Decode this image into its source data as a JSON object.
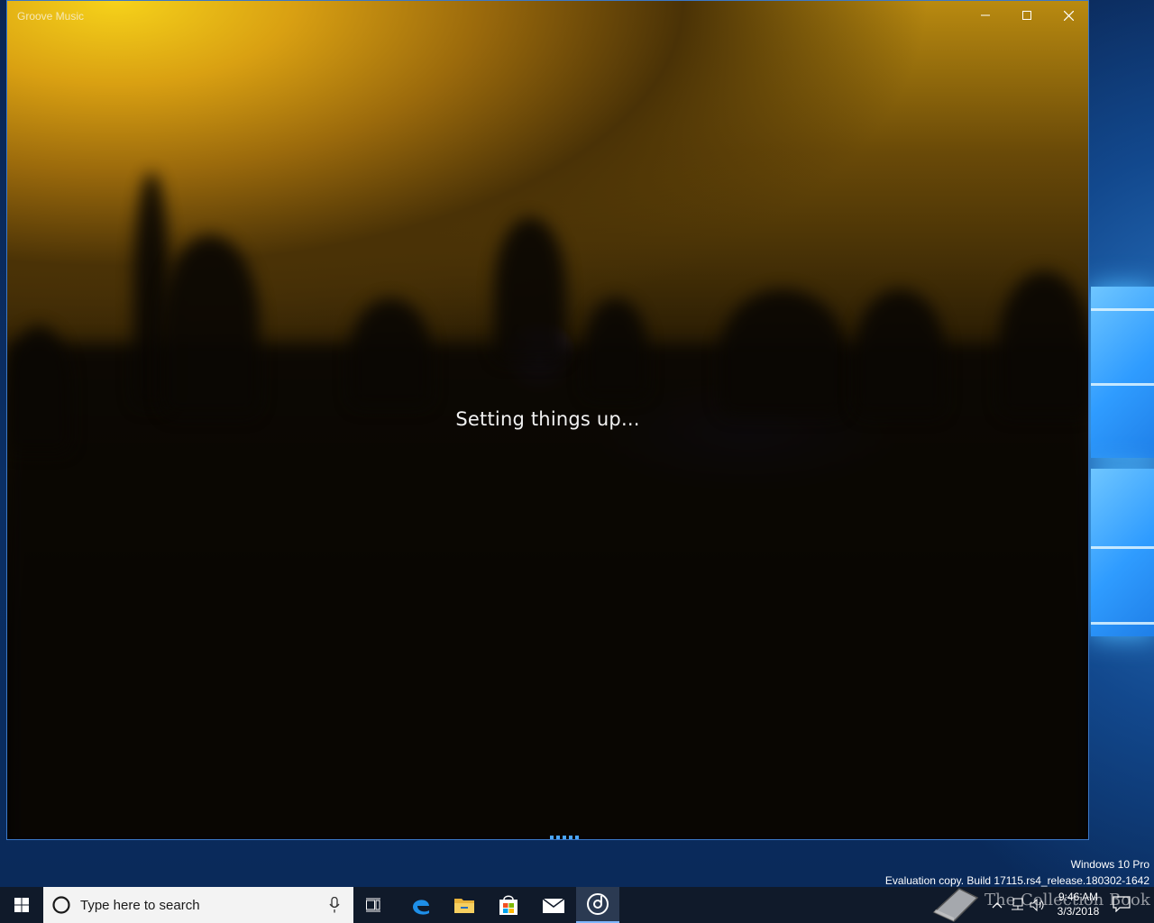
{
  "window": {
    "title": "Groove Music",
    "status": "Setting things up...",
    "controls": {
      "minimize": "minimize-icon",
      "maximize": "maximize-icon",
      "close": "close-icon"
    }
  },
  "desktop": {
    "edition": "Windows 10 Pro",
    "build": "Evaluation copy. Build 17115.rs4_release.180302-1642"
  },
  "taskbar": {
    "search_placeholder": "Type here to search",
    "apps": [
      "task-view-icon",
      "edge-icon",
      "file-explorer-icon",
      "store-icon",
      "mail-icon",
      "groove-music-icon"
    ],
    "active_app": "groove-music-icon",
    "clock": {
      "time": "9:46 AM",
      "date": "3/3/2018"
    }
  },
  "watermark": {
    "text": "The Collection Book"
  },
  "colors": {
    "accent": "#3a78c8",
    "taskbar": "#101a2a",
    "loading": "#4aa6ff"
  }
}
